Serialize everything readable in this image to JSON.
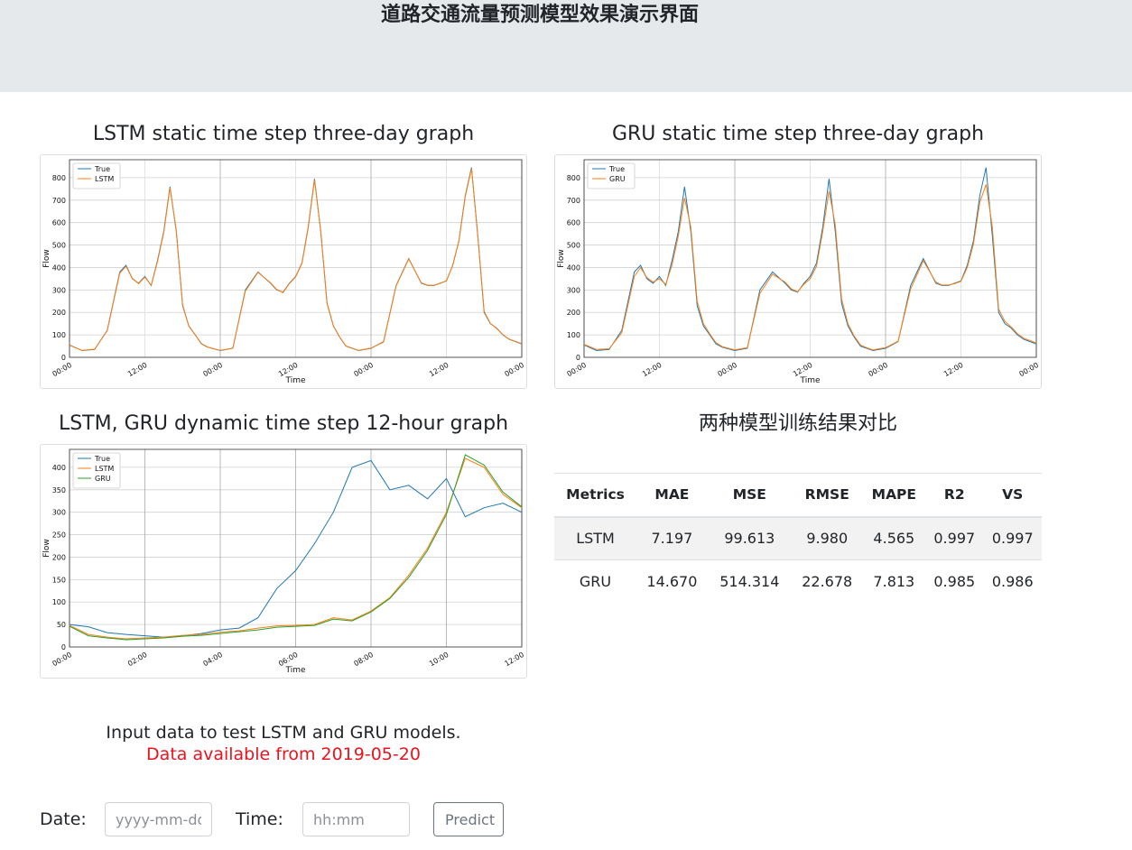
{
  "header": {
    "title": "道路交通流量预测模型效果演示界面"
  },
  "panels": {
    "lstm_static_title": "LSTM static time step three-day graph",
    "gru_static_title": "GRU static time step three-day graph",
    "dynamic_title": "LSTM, GRU dynamic time step 12-hour graph",
    "comparison_title": "两种模型训练结果对比"
  },
  "chart_data": [
    {
      "type": "line",
      "xlabel": "Time",
      "ylabel": "Flow",
      "x_tick_labels": [
        "00:00",
        "12:00",
        "00:00",
        "12:00",
        "00:00",
        "12:00",
        "00:00"
      ],
      "y_ticks": [
        0,
        100,
        200,
        300,
        400,
        500,
        600,
        700,
        800
      ],
      "ylim": [
        0,
        880
      ],
      "grid": true,
      "legend": "top-left",
      "x_hours": [
        0,
        2,
        4,
        6,
        8,
        9,
        10,
        11,
        12,
        13,
        14,
        15,
        16,
        17,
        18,
        19,
        20,
        21,
        22,
        24,
        26,
        28,
        30,
        32,
        33,
        34,
        35,
        36,
        37,
        38,
        39,
        40,
        41,
        42,
        43,
        44,
        45,
        46,
        48,
        50,
        52,
        54,
        56,
        57,
        58,
        59,
        60,
        61,
        62,
        63,
        64,
        65,
        66,
        67,
        68,
        69,
        70,
        72
      ],
      "series": [
        {
          "name": "True",
          "color": "#1f77b4",
          "values": [
            55,
            30,
            35,
            120,
            380,
            410,
            350,
            330,
            360,
            320,
            430,
            560,
            760,
            560,
            230,
            140,
            100,
            60,
            45,
            30,
            40,
            300,
            380,
            330,
            300,
            290,
            330,
            360,
            420,
            580,
            795,
            560,
            240,
            140,
            90,
            50,
            40,
            30,
            40,
            70,
            320,
            440,
            330,
            320,
            320,
            330,
            340,
            410,
            520,
            720,
            845,
            540,
            200,
            150,
            130,
            100,
            80,
            60
          ]
        },
        {
          "name": "LSTM",
          "color": "#ff7f0e",
          "values": [
            54,
            31,
            36,
            118,
            375,
            405,
            352,
            328,
            357,
            322,
            425,
            555,
            755,
            565,
            235,
            138,
            101,
            61,
            46,
            31,
            41,
            295,
            378,
            332,
            302,
            288,
            328,
            358,
            418,
            575,
            790,
            565,
            242,
            141,
            91,
            51,
            41,
            31,
            41,
            68,
            318,
            438,
            332,
            321,
            321,
            329,
            341,
            408,
            518,
            715,
            840,
            545,
            205,
            151,
            128,
            101,
            81,
            61
          ]
        }
      ]
    },
    {
      "type": "line",
      "xlabel": "Time",
      "ylabel": "Flow",
      "x_tick_labels": [
        "00:00",
        "12:00",
        "00:00",
        "12:00",
        "00:00",
        "12:00",
        "00:00"
      ],
      "y_ticks": [
        0,
        100,
        200,
        300,
        400,
        500,
        600,
        700,
        800
      ],
      "ylim": [
        0,
        880
      ],
      "grid": true,
      "legend": "top-left",
      "x_hours": [
        0,
        2,
        4,
        6,
        8,
        9,
        10,
        11,
        12,
        13,
        14,
        15,
        16,
        17,
        18,
        19,
        20,
        21,
        22,
        24,
        26,
        28,
        30,
        32,
        33,
        34,
        35,
        36,
        37,
        38,
        39,
        40,
        41,
        42,
        43,
        44,
        45,
        46,
        48,
        50,
        52,
        54,
        56,
        57,
        58,
        59,
        60,
        61,
        62,
        63,
        64,
        65,
        66,
        67,
        68,
        69,
        70,
        72
      ],
      "series": [
        {
          "name": "True",
          "color": "#1f77b4",
          "values": [
            55,
            30,
            35,
            120,
            380,
            410,
            350,
            330,
            360,
            320,
            430,
            560,
            760,
            560,
            230,
            140,
            100,
            60,
            45,
            30,
            40,
            300,
            380,
            330,
            300,
            290,
            330,
            360,
            420,
            580,
            795,
            560,
            240,
            140,
            90,
            50,
            40,
            30,
            40,
            70,
            320,
            440,
            330,
            320,
            320,
            330,
            340,
            410,
            520,
            720,
            845,
            540,
            200,
            150,
            130,
            100,
            80,
            60
          ]
        },
        {
          "name": "GRU",
          "color": "#ff7f0e",
          "values": [
            58,
            35,
            38,
            110,
            360,
            400,
            355,
            335,
            350,
            325,
            410,
            540,
            710,
            580,
            250,
            150,
            105,
            65,
            48,
            33,
            43,
            285,
            370,
            335,
            305,
            292,
            325,
            350,
            405,
            560,
            740,
            590,
            260,
            150,
            95,
            55,
            43,
            33,
            43,
            72,
            305,
            430,
            335,
            322,
            322,
            328,
            338,
            400,
            505,
            690,
            770,
            580,
            215,
            160,
            135,
            105,
            85,
            64
          ]
        }
      ]
    },
    {
      "type": "line",
      "xlabel": "Time",
      "ylabel": "Flow",
      "x_tick_labels": [
        "00:00",
        "02:00",
        "04:00",
        "06:00",
        "08:00",
        "10:00",
        "12:00"
      ],
      "y_ticks": [
        0,
        50,
        100,
        150,
        200,
        250,
        300,
        350,
        400
      ],
      "ylim": [
        0,
        440
      ],
      "grid": true,
      "legend": "top-left",
      "x_hours": [
        0,
        0.5,
        1,
        1.5,
        2,
        2.5,
        3,
        3.5,
        4,
        4.5,
        5,
        5.5,
        6,
        6.5,
        7,
        7.5,
        8,
        8.5,
        9,
        9.5,
        10,
        10.5,
        11,
        11.5,
        12
      ],
      "series": [
        {
          "name": "True",
          "color": "#1f77b4",
          "values": [
            50,
            45,
            32,
            28,
            25,
            22,
            25,
            30,
            38,
            42,
            65,
            130,
            170,
            230,
            300,
            400,
            415,
            350,
            360,
            330,
            375,
            290,
            310,
            320,
            300
          ]
        },
        {
          "name": "LSTM",
          "color": "#ff7f0e",
          "values": [
            48,
            28,
            22,
            18,
            20,
            22,
            26,
            28,
            33,
            36,
            42,
            47,
            48,
            50,
            65,
            60,
            80,
            110,
            160,
            220,
            300,
            420,
            400,
            340,
            310
          ]
        },
        {
          "name": "GRU",
          "color": "#2ca02c",
          "values": [
            46,
            25,
            20,
            16,
            18,
            20,
            24,
            26,
            30,
            34,
            38,
            44,
            46,
            48,
            62,
            58,
            78,
            108,
            155,
            215,
            295,
            428,
            405,
            345,
            312
          ]
        }
      ]
    }
  ],
  "metrics_table": {
    "headers": [
      "Metrics",
      "MAE",
      "MSE",
      "RMSE",
      "MAPE",
      "R2",
      "VS"
    ],
    "rows": [
      [
        "LSTM",
        "7.197",
        "99.613",
        "9.980",
        "4.565",
        "0.997",
        "0.997"
      ],
      [
        "GRU",
        "14.670",
        "514.314",
        "22.678",
        "7.813",
        "0.985",
        "0.986"
      ]
    ]
  },
  "input_section": {
    "note": "Input data to test LSTM and GRU models.",
    "availability": "Data available from 2019-05-20",
    "date_label": "Date:",
    "date_placeholder": "yyyy-mm-dd",
    "time_label": "Time:",
    "time_placeholder": "hh:mm",
    "predict_label": "Predict"
  }
}
